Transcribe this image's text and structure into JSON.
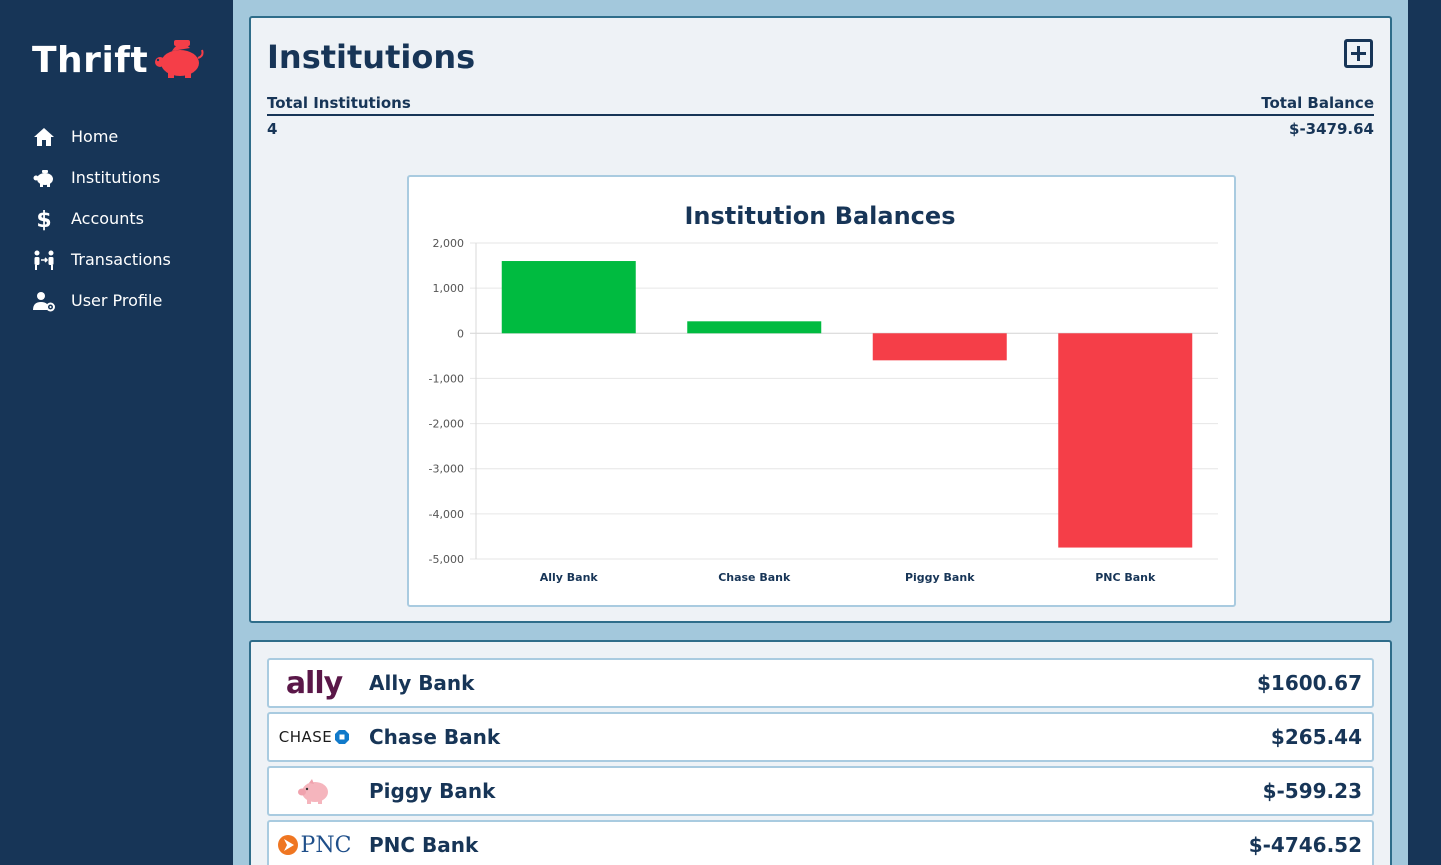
{
  "app": {
    "name": "Thrift"
  },
  "nav": {
    "items": [
      {
        "label": "Home",
        "icon": "home-icon"
      },
      {
        "label": "Institutions",
        "icon": "piggy-bank-icon"
      },
      {
        "label": "Accounts",
        "icon": "dollar-icon"
      },
      {
        "label": "Transactions",
        "icon": "people-transfer-icon"
      },
      {
        "label": "User Profile",
        "icon": "user-gear-icon"
      }
    ]
  },
  "page": {
    "title": "Institutions",
    "add_icon": "plus-square-icon",
    "stats": {
      "total_institutions_label": "Total Institutions",
      "total_balance_label": "Total Balance",
      "total_institutions_value": "4",
      "total_balance_value": "$-3479.64"
    }
  },
  "chart_data": {
    "type": "bar",
    "title": "Institution Balances",
    "xlabel": "",
    "ylabel": "",
    "categories": [
      "Ally Bank",
      "Chase Bank",
      "Piggy Bank",
      "PNC Bank"
    ],
    "values": [
      1600.67,
      265.44,
      -599.23,
      -4746.52
    ],
    "ylim": [
      -5000,
      2000
    ],
    "yticks": [
      "2,000",
      "1,000",
      "0",
      "-1,000",
      "-2,000",
      "-3,000",
      "-4,000",
      "-5,000"
    ],
    "grid": true,
    "colors": {
      "positive": "#00bb40",
      "negative": "#f53e48"
    }
  },
  "institutions": [
    {
      "name": "Ally Bank",
      "balance": "$1600.67",
      "logo_text": "ally"
    },
    {
      "name": "Chase Bank",
      "balance": "$265.44",
      "logo_text": "CHASE"
    },
    {
      "name": "Piggy Bank",
      "balance": "$-599.23",
      "logo_text": ""
    },
    {
      "name": "PNC Bank",
      "balance": "$-4746.52",
      "logo_text": "PNC"
    }
  ],
  "colors": {
    "sidebar": "#173557",
    "background": "#a3c8dc",
    "accent": "#f53e48"
  }
}
